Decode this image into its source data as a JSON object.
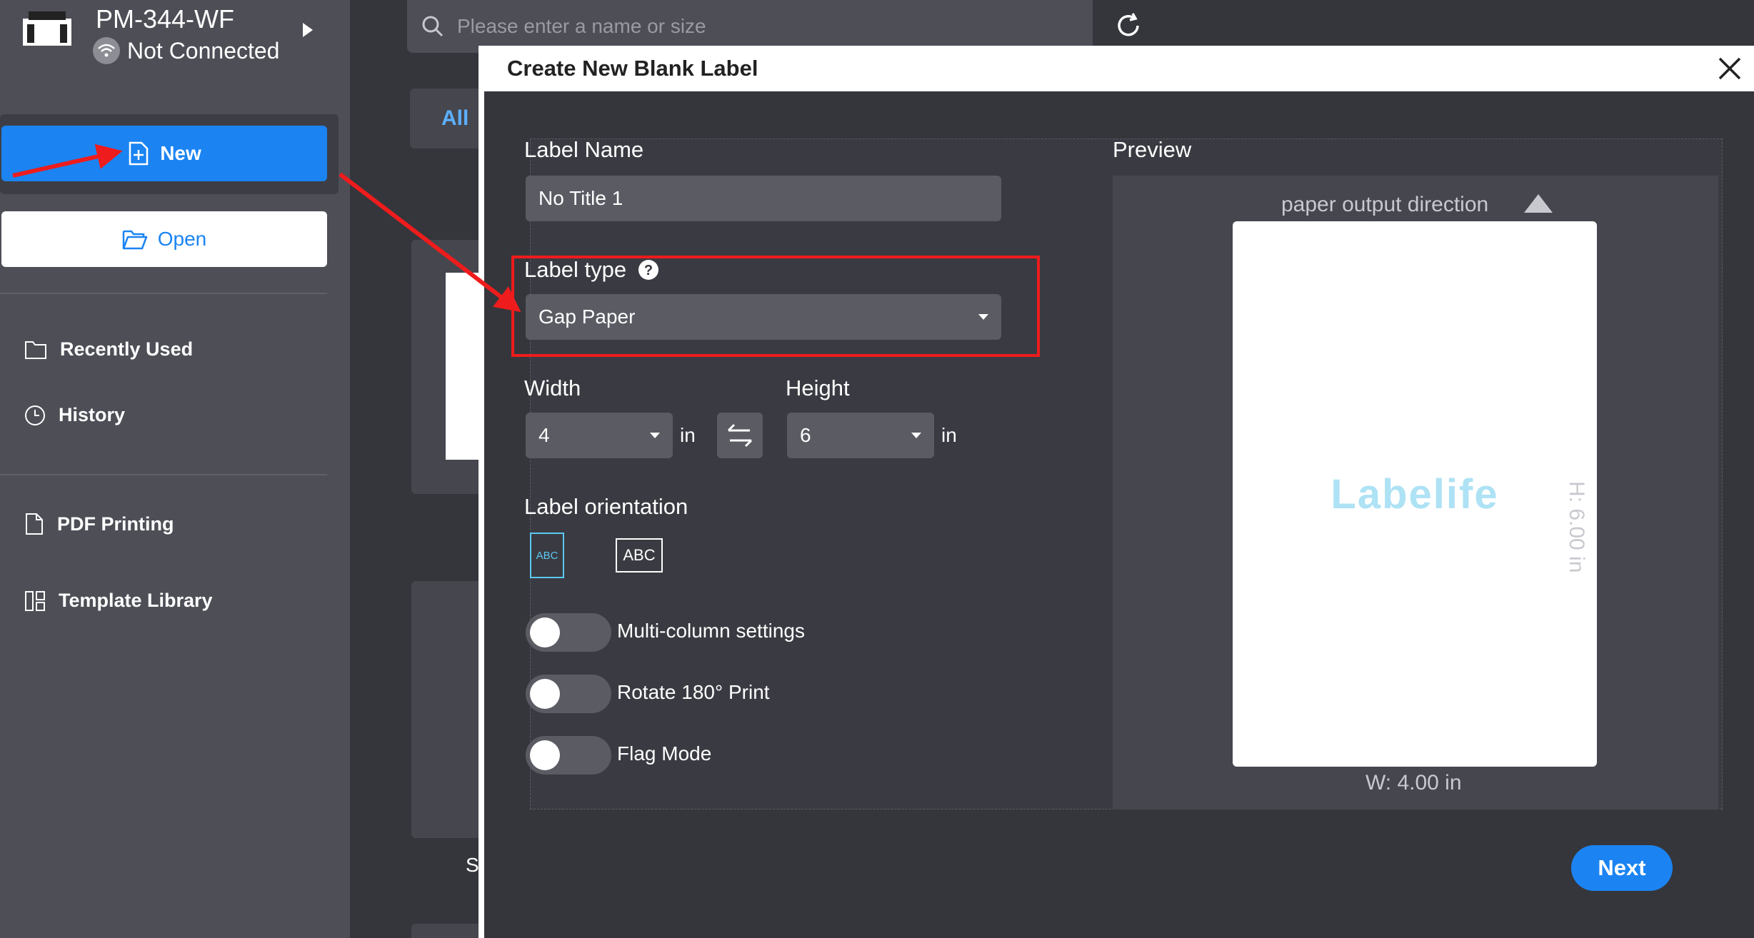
{
  "printer": {
    "name": "PM-344-WF",
    "status": "Not Connected"
  },
  "sidebar": {
    "new_label": "New",
    "open_label": "Open",
    "items": [
      {
        "label": "Recently Used",
        "icon": "folder-icon"
      },
      {
        "label": "History",
        "icon": "clock-icon"
      },
      {
        "label": "PDF Printing",
        "icon": "file-icon"
      },
      {
        "label": "Template Library",
        "icon": "grid-icon"
      }
    ]
  },
  "search": {
    "placeholder": "Please enter a name or size"
  },
  "main": {
    "all_tab": "All",
    "partial_text": "S"
  },
  "dialog": {
    "title": "Create New Blank Label",
    "label_name": {
      "label": "Label Name",
      "value": "No Title 1"
    },
    "label_type": {
      "label": "Label type",
      "value": "Gap Paper"
    },
    "width": {
      "label": "Width",
      "value": "4",
      "unit": "in"
    },
    "height": {
      "label": "Height",
      "value": "6",
      "unit": "in"
    },
    "orientation": {
      "label": "Label orientation",
      "vertical_text": "ABC",
      "horizontal_text": "ABC"
    },
    "toggles": [
      {
        "label": "Multi-column settings",
        "on": false
      },
      {
        "label": "Rotate 180° Print",
        "on": false
      },
      {
        "label": "Flag Mode",
        "on": false
      }
    ],
    "preview": {
      "label": "Preview",
      "direction_text": "paper output direction",
      "logo_text": "Labelife",
      "height_text": "H: 6.00 in",
      "width_text": "W: 4.00 in"
    },
    "next_label": "Next"
  },
  "colors": {
    "accent": "#1b84f2",
    "annotation": "#ee1c1c"
  }
}
